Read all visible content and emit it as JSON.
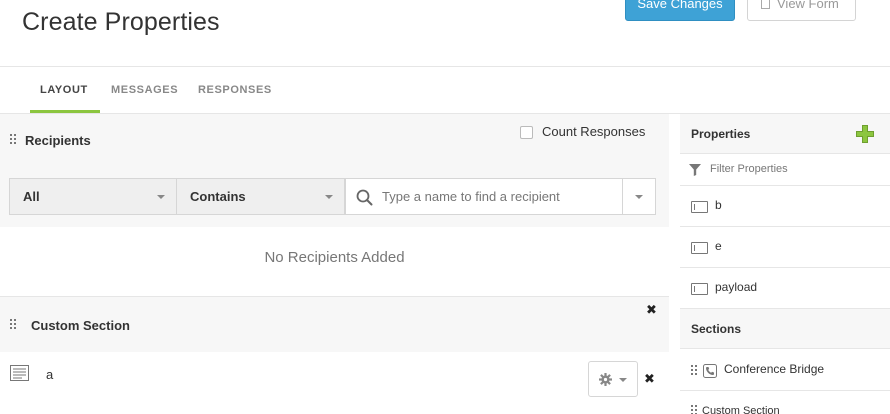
{
  "page": {
    "title": "Create Properties"
  },
  "actions": {
    "save_label": "Save Changes",
    "view_label": "View Form"
  },
  "tabs": [
    {
      "label": "LAYOUT",
      "active": true
    },
    {
      "label": "MESSAGES",
      "active": false
    },
    {
      "label": "RESPONSES",
      "active": false
    }
  ],
  "recipients": {
    "title": "Recipients",
    "count_responses_label": "Count Responses",
    "count_responses_checked": false,
    "type_filter": "All",
    "match_filter": "Contains",
    "search_placeholder": "Type a name to find a recipient",
    "empty_message": "No Recipients Added"
  },
  "custom_section": {
    "title": "Custom Section",
    "field_label": "a"
  },
  "properties_panel": {
    "title": "Properties",
    "filter_placeholder": "Filter Properties",
    "items": [
      {
        "label": "b"
      },
      {
        "label": "e"
      },
      {
        "label": "payload"
      }
    ]
  },
  "sections_panel": {
    "title": "Sections",
    "items": [
      {
        "label": "Conference Bridge"
      },
      {
        "label": "Custom Section"
      }
    ]
  },
  "colors": {
    "accent_green": "#8cc63f",
    "button_blue": "#3ea2d6"
  },
  "icons": [
    "drag-handle-icon",
    "search-icon",
    "chevron-down-icon",
    "close-icon",
    "gear-icon",
    "add-icon",
    "filter-icon",
    "text-field-icon",
    "phone-icon",
    "doc-icon"
  ]
}
